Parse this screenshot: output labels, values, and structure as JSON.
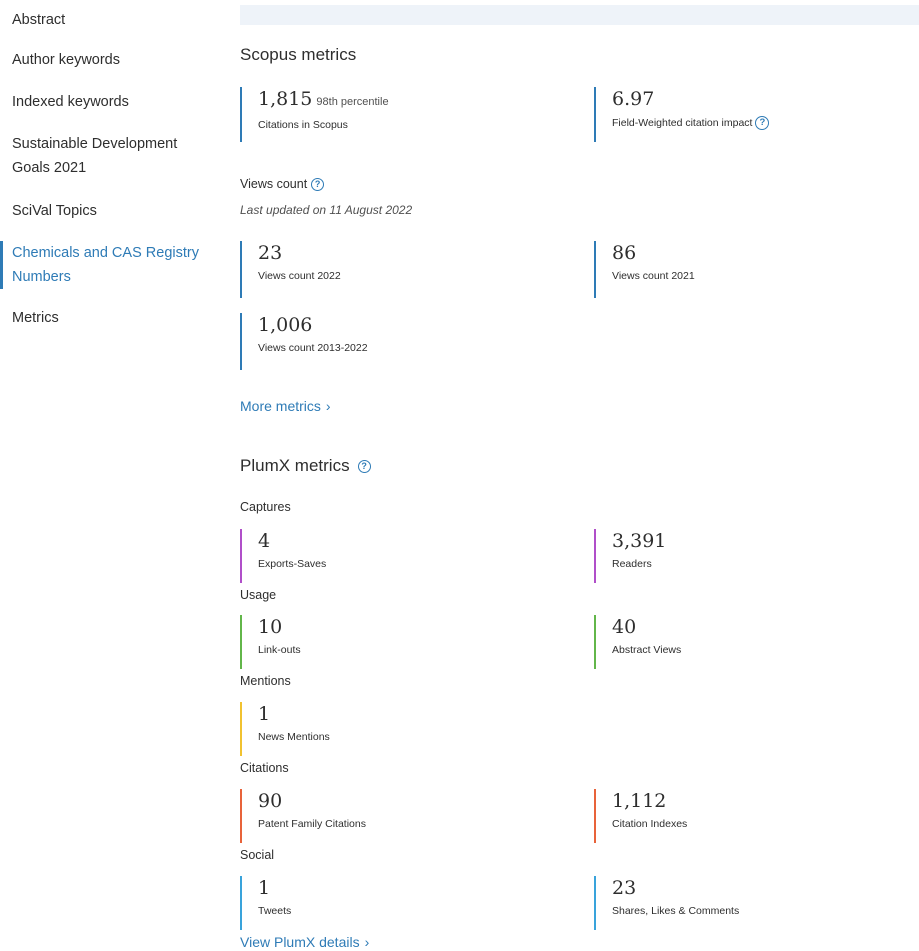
{
  "sidebar": {
    "items": [
      {
        "label": "Abstract"
      },
      {
        "label": "Author keywords"
      },
      {
        "label": "Indexed keywords"
      },
      {
        "label": "Sustainable Development Goals 2021"
      },
      {
        "label": "SciVal Topics"
      },
      {
        "label": "Chemicals and CAS Registry Numbers",
        "active": true
      },
      {
        "label": "Metrics"
      }
    ]
  },
  "scopus": {
    "title": "Scopus metrics",
    "citations": {
      "value": "1,815",
      "percentile": "98th percentile",
      "label": "Citations in Scopus"
    },
    "fwci": {
      "value": "6.97",
      "label": "Field-Weighted citation impact"
    },
    "views": {
      "heading": "Views count",
      "updated": "Last updated on 11 August 2022",
      "items": [
        {
          "value": "23",
          "label": "Views count 2022"
        },
        {
          "value": "86",
          "label": "Views count 2021"
        },
        {
          "value": "1,006",
          "label": "Views count 2013-2022"
        }
      ]
    },
    "more_link": "More metrics"
  },
  "plumx": {
    "title": "PlumX metrics",
    "groups": {
      "captures": {
        "heading": "Captures",
        "items": [
          {
            "value": "4",
            "label": "Exports-Saves"
          },
          {
            "value": "3,391",
            "label": "Readers"
          }
        ]
      },
      "usage": {
        "heading": "Usage",
        "items": [
          {
            "value": "10",
            "label": "Link-outs"
          },
          {
            "value": "40",
            "label": "Abstract Views"
          }
        ]
      },
      "mentions": {
        "heading": "Mentions",
        "items": [
          {
            "value": "1",
            "label": "News Mentions"
          }
        ]
      },
      "citations": {
        "heading": "Citations",
        "items": [
          {
            "value": "90",
            "label": "Patent Family Citations"
          },
          {
            "value": "1,112",
            "label": "Citation Indexes"
          }
        ]
      },
      "social": {
        "heading": "Social",
        "items": [
          {
            "value": "1",
            "label": "Tweets"
          },
          {
            "value": "23",
            "label": "Shares, Likes & Comments"
          }
        ]
      }
    },
    "details_link": "View PlumX details"
  },
  "icons": {
    "help": "help-circle-icon",
    "chevron": "chevron-right-icon"
  },
  "colors": {
    "accent": "#2e7bb6",
    "captures": "#b04fc9",
    "usage": "#62b64a",
    "mentions": "#f1c230",
    "citations": "#e8633a",
    "social": "#39a3db"
  }
}
